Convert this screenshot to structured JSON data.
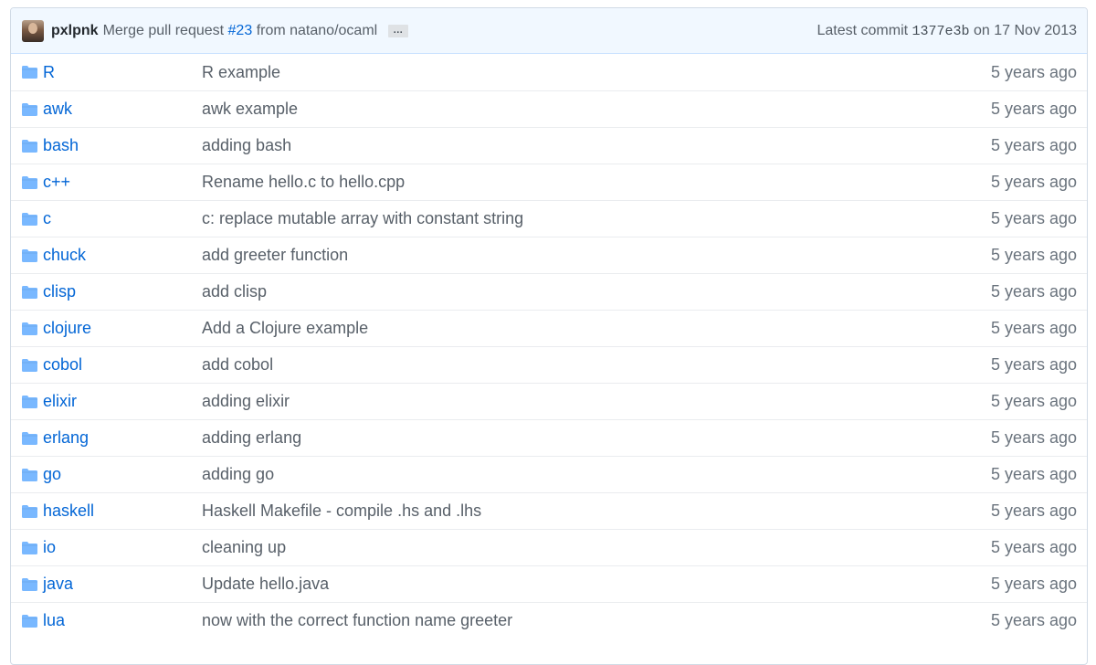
{
  "commit": {
    "author": "pxlpnk",
    "message_prefix": "Merge pull request",
    "pr_number": "#23",
    "message_suffix": "from natano/ocaml",
    "ellipsis": "…",
    "latest_label": "Latest commit",
    "sha": "1377e3b",
    "date_text": "on 17 Nov 2013"
  },
  "colors": {
    "link": "#0366d6",
    "folder_icon": "#79b8ff",
    "commit_bar_bg": "#f1f8ff"
  },
  "icons": {
    "folder": "folder-icon"
  },
  "files": [
    {
      "name": "R",
      "message": "R example",
      "age": "5 years ago"
    },
    {
      "name": "awk",
      "message": "awk example",
      "age": "5 years ago"
    },
    {
      "name": "bash",
      "message": "adding bash",
      "age": "5 years ago"
    },
    {
      "name": "c++",
      "message": "Rename hello.c to hello.cpp",
      "age": "5 years ago"
    },
    {
      "name": "c",
      "message": "c: replace mutable array with constant string",
      "age": "5 years ago"
    },
    {
      "name": "chuck",
      "message": "add greeter function",
      "age": "5 years ago"
    },
    {
      "name": "clisp",
      "message": "add clisp",
      "age": "5 years ago"
    },
    {
      "name": "clojure",
      "message": "Add a Clojure example",
      "age": "5 years ago"
    },
    {
      "name": "cobol",
      "message": "add cobol",
      "age": "5 years ago"
    },
    {
      "name": "elixir",
      "message": "adding elixir",
      "age": "5 years ago"
    },
    {
      "name": "erlang",
      "message": "adding erlang",
      "age": "5 years ago"
    },
    {
      "name": "go",
      "message": "adding go",
      "age": "5 years ago"
    },
    {
      "name": "haskell",
      "message": "Haskell Makefile - compile .hs and .lhs",
      "age": "5 years ago"
    },
    {
      "name": "io",
      "message": "cleaning up",
      "age": "5 years ago"
    },
    {
      "name": "java",
      "message": "Update hello.java",
      "age": "5 years ago"
    },
    {
      "name": "lua",
      "message": "now with the correct function name greeter",
      "age": "5 years ago"
    }
  ]
}
